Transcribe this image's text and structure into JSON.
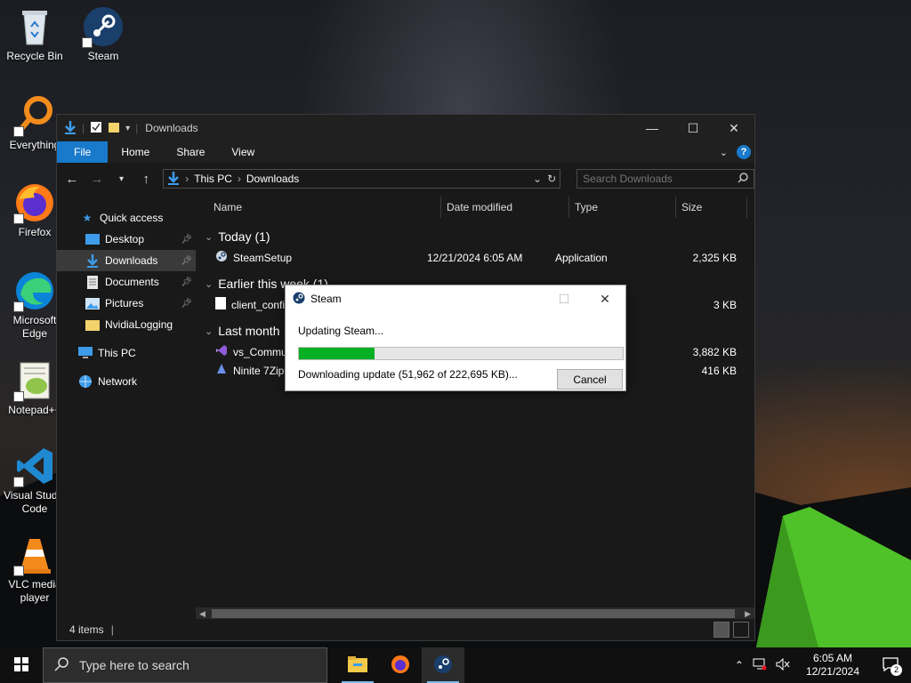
{
  "desktop": {
    "icons": [
      {
        "label": "Recycle Bin"
      },
      {
        "label": "Steam"
      },
      {
        "label": "Everything"
      },
      {
        "label": "Firefox"
      },
      {
        "label": "Microsoft Edge"
      },
      {
        "label": "Notepad++"
      },
      {
        "label": "Visual Studio Code"
      },
      {
        "label": "VLC media player"
      }
    ]
  },
  "explorer": {
    "title": "Downloads",
    "ribbon_tabs": [
      "File",
      "Home",
      "Share",
      "View"
    ],
    "address": {
      "root": "This PC",
      "current": "Downloads"
    },
    "search_placeholder": "Search Downloads",
    "nav_pane": {
      "quick_access": "Quick access",
      "items": [
        "Desktop",
        "Downloads",
        "Documents",
        "Pictures",
        "NvidiaLogging"
      ],
      "this_pc": "This PC",
      "network": "Network"
    },
    "columns": [
      "Name",
      "Date modified",
      "Type",
      "Size"
    ],
    "groups": [
      {
        "title": "Today (1)",
        "files": [
          {
            "name": "SteamSetup",
            "date": "12/21/2024 6:05 AM",
            "type": "Application",
            "size": "2,325 KB"
          }
        ]
      },
      {
        "title": "Earlier this week (1)",
        "files": [
          {
            "name": "client_config",
            "date": "",
            "type": "",
            "size": "3 KB"
          }
        ]
      },
      {
        "title": "Last month",
        "files": [
          {
            "name": "vs_Community",
            "date": "",
            "type": "",
            "size": "3,882 KB"
          },
          {
            "name": "Ninite 7Zip",
            "date": "",
            "type": "",
            "size": "416 KB"
          }
        ]
      }
    ],
    "status": "4 items"
  },
  "steam_dialog": {
    "title": "Steam",
    "status": "Updating Steam...",
    "progress_fraction": 0.233,
    "detail": "Downloading update (51,962 of 222,695 KB)...",
    "cancel_label": "Cancel"
  },
  "taskbar": {
    "search_placeholder": "Type here to search",
    "time": "6:05 AM",
    "date": "12/21/2024",
    "notification_count": "2"
  },
  "colors": {
    "accent": "#1979ca",
    "progress": "#06b025"
  }
}
